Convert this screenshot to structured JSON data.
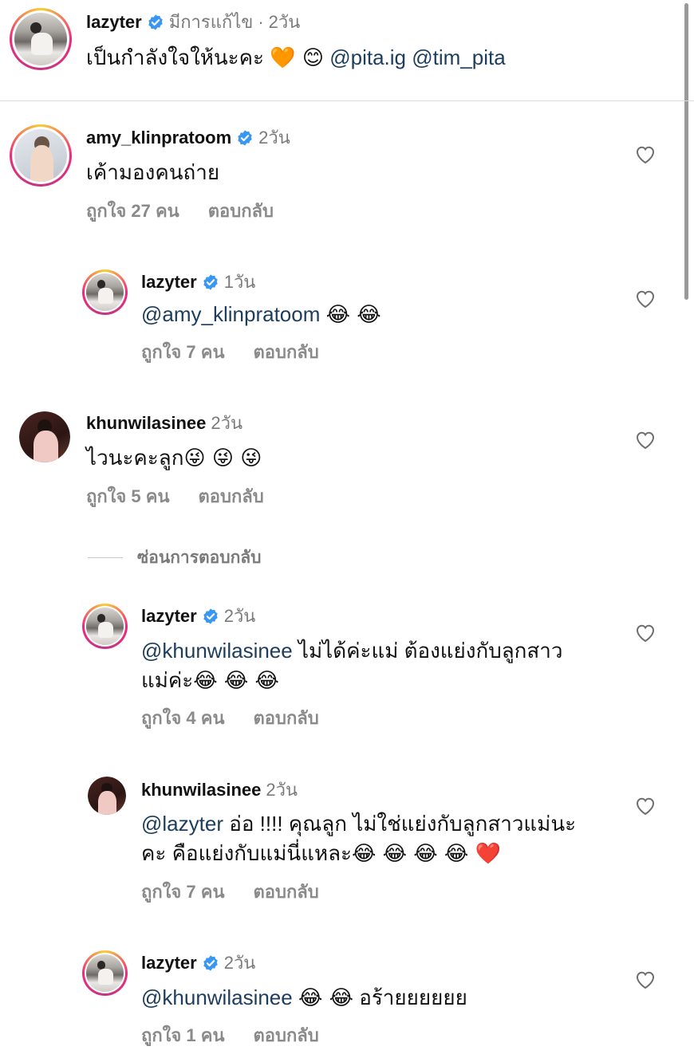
{
  "caption": {
    "username": "lazyter",
    "edited_label": "มีการแก้ไข",
    "separator": "·",
    "time": "2วัน",
    "text": "เป็นกำลังใจให้นะคะ",
    "emojis": "🧡 😊",
    "mention1": "@pita.ig",
    "mention2": "@tim_pita"
  },
  "comments": [
    {
      "username": "amy_klinpratoom",
      "verified": true,
      "time": "2วัน",
      "text": "เค้ามองคนถ่าย",
      "likes": "ถูกใจ 27 คน",
      "reply_label": "ตอบกลับ"
    },
    {
      "username": "lazyter",
      "verified": true,
      "time": "1วัน",
      "mention": "@amy_klinpratoom",
      "emojis": "😂 😂",
      "likes": "ถูกใจ 7 คน",
      "reply_label": "ตอบกลับ"
    },
    {
      "username": "khunwilasinee",
      "verified": false,
      "time": "2วัน",
      "text": "ไวนะคะลูก",
      "emojis": "😜 😜 😜",
      "likes": "ถูกใจ 5 คน",
      "reply_label": "ตอบกลับ"
    },
    {
      "username": "lazyter",
      "verified": true,
      "time": "2วัน",
      "mention": "@khunwilasinee",
      "text_line1": " ไม่ได้ค่ะแม่ ต้องแย่งกับลูกสาว",
      "text_line2": "แม่ค่ะ",
      "emojis": "😂 😂 😂",
      "likes": "ถูกใจ 4 คน",
      "reply_label": "ตอบกลับ"
    },
    {
      "username": "khunwilasinee",
      "verified": false,
      "time": "2วัน",
      "mention": "@lazyter",
      "text_line1": " อ่อ !!!! คุณลูก ไม่ใช่แย่งกับลูกสาวแม่นะ",
      "text_line2": "คะ คือแย่งกับแม่นี่แหละ",
      "emojis": "😂 😂 😂 😂 ❤️",
      "likes": "ถูกใจ 7 คน",
      "reply_label": "ตอบกลับ"
    },
    {
      "username": "lazyter",
      "verified": true,
      "time": "2วัน",
      "mention": "@khunwilasinee",
      "emojis": "😂 😂",
      "text": "อร้ายยยยยย",
      "likes": "ถูกใจ 1 คน",
      "reply_label": "ตอบกลับ"
    }
  ],
  "hide_replies_label": "ซ่อนการตอบกลับ",
  "colors": {
    "mention": "#1c3d5e",
    "verified": "#3897f0",
    "meta": "#8a8a8a"
  }
}
